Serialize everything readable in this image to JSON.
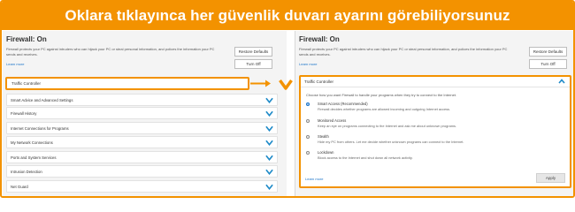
{
  "banner": {
    "text": "Oklara tıklayınca her güvenlik duvarı ayarını görebiliyorsunuz"
  },
  "colors": {
    "accent": "#f39200",
    "link": "#1a73c9",
    "chevron": "#1e8ac8"
  },
  "firewall": {
    "title": "Firewall: On",
    "description": "Firewall protects your PC against intruders who can hijack your PC or steal personal information, and polices the information your PC sends and receives.",
    "learn_more": "Learn more",
    "restore_defaults": "Restore Defaults",
    "turn_off": "Turn Off"
  },
  "sections": [
    {
      "label": "Traffic Controller"
    },
    {
      "label": "Smart Advice and Advanced Settings"
    },
    {
      "label": "Firewall History"
    },
    {
      "label": "Internet Connections for Programs"
    },
    {
      "label": "My Network Connections"
    },
    {
      "label": "Ports and System Services"
    },
    {
      "label": "Intrusion Detection"
    },
    {
      "label": "Net Guard"
    }
  ],
  "traffic_controller": {
    "title": "Traffic Controller",
    "intro": "Choose how you want Firewall to handle your programs when they try to connect to the Internet.",
    "options": [
      {
        "name": "Smart Access (Recommended)",
        "desc": "Firewall decides whether programs are allowed incoming and outgoing Internet access.",
        "selected": true
      },
      {
        "name": "Monitored Access",
        "desc": "Keep an eye on programs connecting to the Internet and ask me about unknown programs.",
        "selected": false
      },
      {
        "name": "Stealth",
        "desc": "Hide my PC from others. Let me decide whether unknown programs can connect to the Internet.",
        "selected": false
      },
      {
        "name": "Lockdown",
        "desc": "Block access to the Internet and shut down all network activity.",
        "selected": false
      }
    ],
    "learn_more": "Learn more",
    "apply": "Apply"
  }
}
